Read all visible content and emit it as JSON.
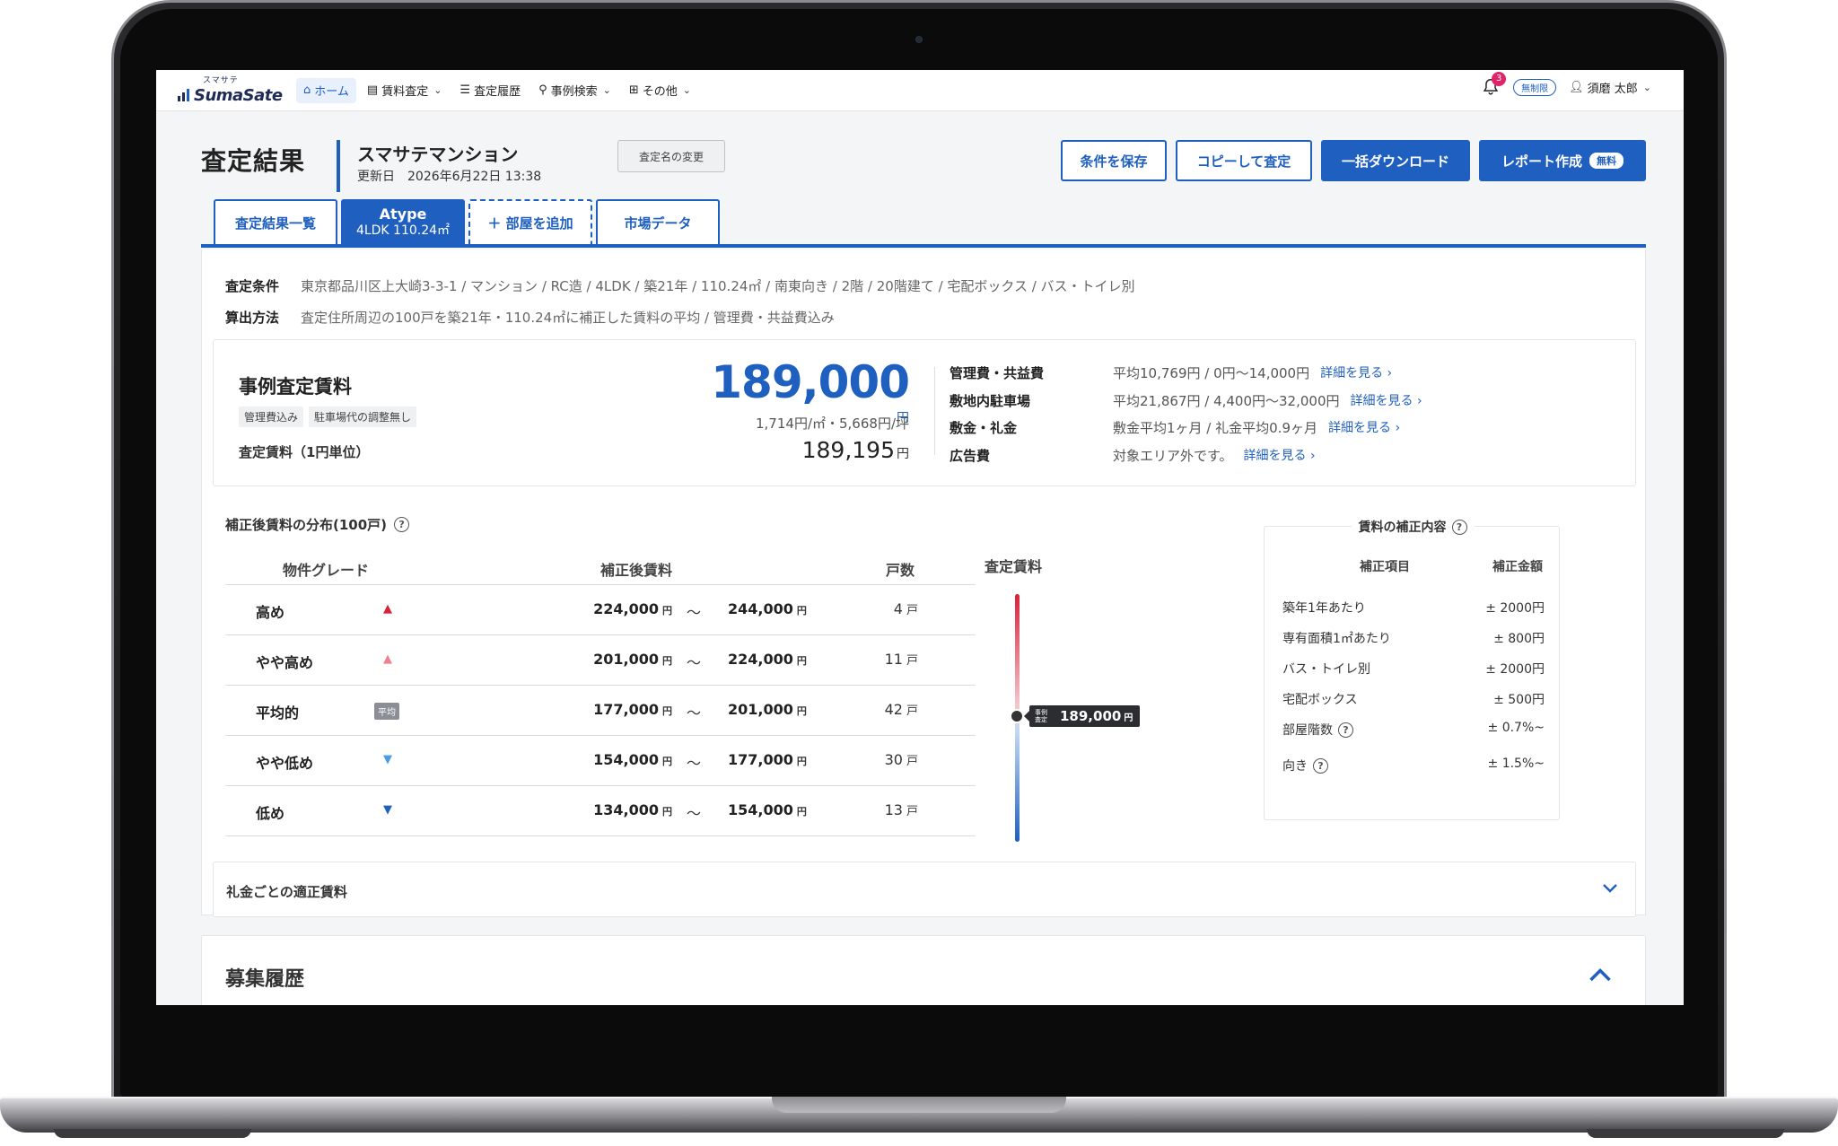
{
  "header": {
    "logo_ruby": "スマサテ",
    "logo_text": "SumaSate",
    "nav": [
      {
        "label": "ホーム",
        "icon": "home-icon",
        "dropdown": false,
        "active": true
      },
      {
        "label": "賃料査定",
        "icon": "calculator-icon",
        "dropdown": true,
        "active": false
      },
      {
        "label": "査定履歴",
        "icon": "list-icon",
        "dropdown": false,
        "active": false
      },
      {
        "label": "事例検索",
        "icon": "search-icon",
        "dropdown": true,
        "active": false
      },
      {
        "label": "その他",
        "icon": "grid-icon",
        "dropdown": true,
        "active": false
      }
    ],
    "notification_count": "3",
    "plan_badge": "無制限",
    "user_name": "須磨 太郎"
  },
  "page": {
    "title": "査定結果",
    "property_name": "スマサテマンション",
    "updated_label": "更新日",
    "updated_value": "2026年6月22日 13:38",
    "rename_button": "査定名の変更",
    "actions": {
      "save": "条件を保存",
      "copy": "コピーして査定",
      "download": "一括ダウンロード",
      "report": "レポート作成",
      "report_badge": "無料"
    }
  },
  "tabs": {
    "list": "査定結果一覧",
    "room_title": "Atype",
    "room_sub": "4LDK 110.24㎡",
    "add_room": "＋ 部屋を追加",
    "market": "市場データ"
  },
  "conditions": {
    "cond_label": "査定条件",
    "cond_value": "東京都品川区上大崎3-3-1 / マンション / RC造 / 4LDK / 築21年 / 110.24㎡ / 南東向き / 2階 / 20階建て / 宅配ボックス / バス・トイレ別",
    "method_label": "算出方法",
    "method_value": "査定住所周辺の100戸を築21年・110.24㎡に補正した賃料の平均 / 管理費・共益費込み"
  },
  "summary": {
    "title": "事例査定賃料",
    "chips": [
      "管理費込み",
      "駐車場代の調整無し"
    ],
    "unit_label": "査定賃料（1円単位）",
    "amount": "189,000",
    "yen": "円",
    "per_unit": "1,714円/㎡・5,668円/坪",
    "exact_amount": "189,195",
    "fees": [
      {
        "label": "管理費・共益費",
        "value": "平均10,769円 / 0円〜14,000円",
        "link": "詳細を見る ›"
      },
      {
        "label": "敷地内駐車場",
        "value": "平均21,867円 / 4,400円〜32,000円",
        "link": "詳細を見る ›"
      },
      {
        "label": "敷金・礼金",
        "value": "敷金平均1ヶ月 / 礼金平均0.9ヶ月",
        "link": "詳細を見る ›"
      },
      {
        "label": "広告費",
        "value": "対象エリア外です。",
        "link": "詳細を見る ›"
      }
    ]
  },
  "distribution": {
    "title": "補正後賃料の分布(100戸)",
    "col_grade": "物件グレード",
    "col_rent": "補正後賃料",
    "col_count": "戸数",
    "col_gauge": "査定賃料",
    "yen_small": "円",
    "tilde": "〜",
    "count_unit": "戸",
    "avg_badge": "平均",
    "rows": [
      {
        "grade": "高め",
        "marker": "up-strong",
        "low": "224,000",
        "high": "244,000",
        "count": "4"
      },
      {
        "grade": "やや高め",
        "marker": "up-light",
        "low": "201,000",
        "high": "224,000",
        "count": "11"
      },
      {
        "grade": "平均的",
        "marker": "average",
        "low": "177,000",
        "high": "201,000",
        "count": "42"
      },
      {
        "grade": "やや低め",
        "marker": "down-light",
        "low": "154,000",
        "high": "177,000",
        "count": "30"
      },
      {
        "grade": "低め",
        "marker": "down-strong",
        "low": "134,000",
        "high": "154,000",
        "count": "13"
      }
    ],
    "gauge_tip_label": "事例査定",
    "gauge_value": "189,000",
    "colors": {
      "high": "#d8223a",
      "high_light": "#f07f91",
      "low_light": "#4a9be8",
      "low": "#1f5fbf"
    }
  },
  "adjustments": {
    "title": "賃料の補正内容",
    "col_item": "補正項目",
    "col_amount": "補正金額",
    "rows": [
      {
        "item": "築年1年あたり",
        "amount": "± 2000円",
        "help": false
      },
      {
        "item": "専有面積1㎡あたり",
        "amount": "± 800円",
        "help": false
      },
      {
        "item": "バス・トイレ別",
        "amount": "± 2000円",
        "help": false
      },
      {
        "item": "宅配ボックス",
        "amount": "± 500円",
        "help": false
      },
      {
        "item": "部屋階数",
        "amount": "± 0.7%~",
        "help": true
      },
      {
        "item": "向き",
        "amount": "± 1.5%~",
        "help": true
      }
    ]
  },
  "accordion": {
    "key_money": "礼金ごとの適正賃料"
  },
  "history": {
    "title": "募集履歴"
  },
  "theme": {
    "accent": "#1f5fbf",
    "badge": "#e0246a"
  }
}
